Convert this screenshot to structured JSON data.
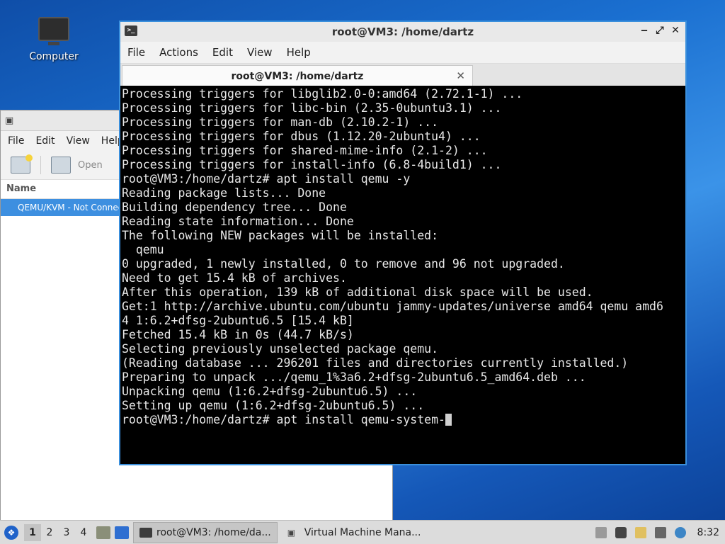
{
  "desktop": {
    "computer_label": "Computer"
  },
  "vmm": {
    "menu": [
      "File",
      "Edit",
      "View",
      "Help"
    ],
    "open_label": "Open",
    "column_name": "Name",
    "connection_row": "QEMU/KVM - Not Connected"
  },
  "terminal": {
    "title": "root@VM3: /home/dartz",
    "menu": [
      "File",
      "Actions",
      "Edit",
      "View",
      "Help"
    ],
    "tab_title": "root@VM3: /home/dartz",
    "lines": [
      "Processing triggers for libglib2.0-0:amd64 (2.72.1-1) ...",
      "Processing triggers for libc-bin (2.35-0ubuntu3.1) ...",
      "Processing triggers for man-db (2.10.2-1) ...",
      "Processing triggers for dbus (1.12.20-2ubuntu4) ...",
      "Processing triggers for shared-mime-info (2.1-2) ...",
      "Processing triggers for install-info (6.8-4build1) ...",
      "root@VM3:/home/dartz# apt install qemu -y",
      "Reading package lists... Done",
      "Building dependency tree... Done",
      "Reading state information... Done",
      "The following NEW packages will be installed:",
      "  qemu",
      "0 upgraded, 1 newly installed, 0 to remove and 96 not upgraded.",
      "Need to get 15.4 kB of archives.",
      "After this operation, 139 kB of additional disk space will be used.",
      "Get:1 http://archive.ubuntu.com/ubuntu jammy-updates/universe amd64 qemu amd6",
      "4 1:6.2+dfsg-2ubuntu6.5 [15.4 kB]",
      "Fetched 15.4 kB in 0s (44.7 kB/s)",
      "Selecting previously unselected package qemu.",
      "(Reading database ... 296201 files and directories currently installed.)",
      "Preparing to unpack .../qemu_1%3a6.2+dfsg-2ubuntu6.5_amd64.deb ...",
      "Unpacking qemu (1:6.2+dfsg-2ubuntu6.5) ...",
      "Setting up qemu (1:6.2+dfsg-2ubuntu6.5) ..."
    ],
    "prompt_line": "root@VM3:/home/dartz# apt install qemu-system-"
  },
  "taskbar": {
    "workspaces": [
      "1",
      "2",
      "3",
      "4"
    ],
    "active_workspace": "1",
    "tasks": [
      {
        "label": "root@VM3: /home/da...",
        "icon": "terminal-icon",
        "active": true
      },
      {
        "label": "Virtual Machine Mana...",
        "icon": "vmm-icon",
        "active": false
      }
    ],
    "clock": "8:32"
  }
}
